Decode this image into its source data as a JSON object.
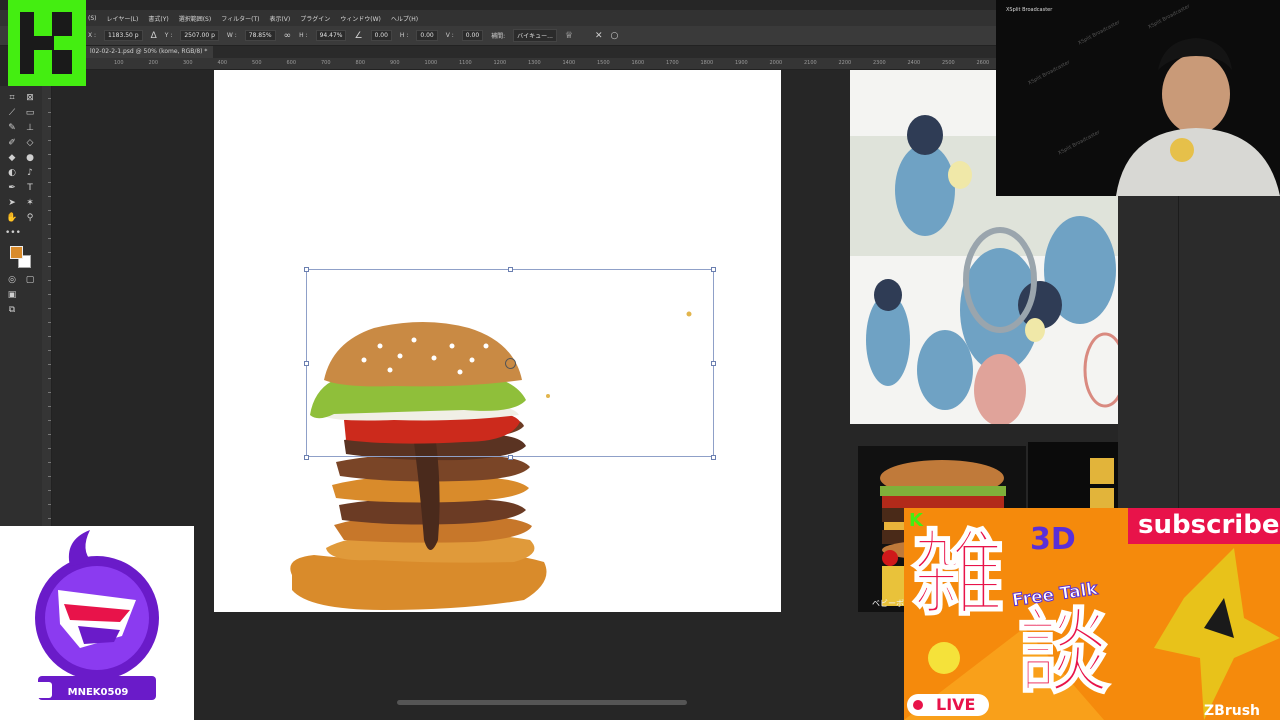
{
  "photoshop": {
    "menu": [
      "(S)",
      "レイヤー(L)",
      "書式(Y)",
      "選択範囲(S)",
      "フィルター(T)",
      "表示(V)",
      "プラグイン",
      "ウィンドウ(W)",
      "ヘルプ(H)"
    ],
    "options": {
      "x_label": "X :",
      "x_value": "1183.50 p",
      "y_label": "Y :",
      "y_value": "2507.00 p",
      "w_label": "W :",
      "w_value": "78.85%",
      "h_label": "H :",
      "h_value": "94.47%",
      "angle_value": "0.00",
      "hskew_label": "H :",
      "hskew_value": "0.00",
      "vskew_label": "V :",
      "vskew_value": "0.00",
      "interp_label": "補間:",
      "interp_value": "バイキュー..."
    },
    "doc_tab": "l02-02-2-1.psd @ 50% (kome, RGB/8) *",
    "ruler_ticks": [
      "100",
      "200",
      "300",
      "400",
      "500",
      "600",
      "700",
      "800",
      "900",
      "1000",
      "1100",
      "1200",
      "1300",
      "1400",
      "1500",
      "1600",
      "1700",
      "1800",
      "1900",
      "2000",
      "2100",
      "2200",
      "2300",
      "2400",
      "2500",
      "2600"
    ],
    "foreground_color": "#d98b2b",
    "background_color": "#ffffff"
  },
  "icons": {
    "crop": "crop-icon",
    "frame": "frame-icon",
    "eyedropper": "eyedropper-icon",
    "spot_heal": "healing-brush-icon",
    "brush": "brush-icon",
    "stamp": "clone-stamp-icon",
    "history_brush": "history-brush-icon",
    "eraser": "eraser-icon",
    "bucket": "paint-bucket-icon",
    "blur": "blur-icon",
    "dodge": "dodge-icon",
    "pen": "pen-icon",
    "type": "type-icon",
    "path_select": "path-selection-icon",
    "shape": "shape-icon",
    "hand": "hand-icon",
    "zoom": "zoom-icon",
    "more": "more-tools-icon",
    "quick_mask": "quick-mask-icon",
    "screen_mode": "screen-mode-icon",
    "cancel": "cancel-transform-icon",
    "commit": "commit-transform-icon"
  },
  "overlay": {
    "obs_label": "XSplit Broadcaster",
    "watermark": "XSplit Broadcaster",
    "channel_name": "MNEK0509",
    "thumbnail": {
      "badge": "K",
      "tag3d": "3D",
      "subscribe": "subscribe",
      "kanji_top": "雑",
      "kanji_bottom": "談",
      "free_talk": "Free Talk",
      "live": "LIVE",
      "zbrush": "ZBrush"
    },
    "reference_text": "ベビーボデ"
  }
}
